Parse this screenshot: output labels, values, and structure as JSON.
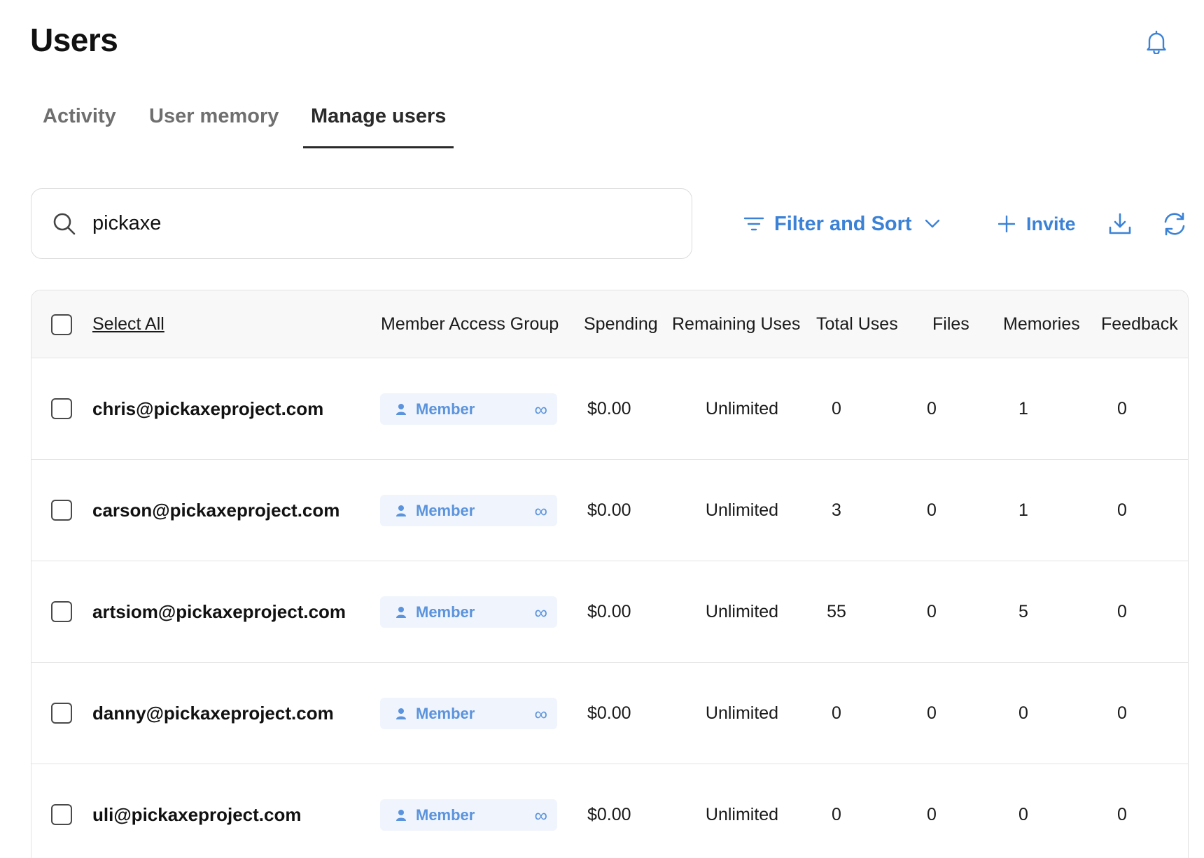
{
  "header": {
    "title": "Users"
  },
  "tabs": [
    {
      "label": "Activity",
      "active": false
    },
    {
      "label": "User memory",
      "active": false
    },
    {
      "label": "Manage users",
      "active": true
    }
  ],
  "search": {
    "value": "pickaxe",
    "icon": "search-icon"
  },
  "toolbar": {
    "filter_label": "Filter and Sort",
    "invite_label": "Invite",
    "icons": [
      "filter-icon",
      "chevron-down-icon",
      "plus-icon",
      "download-icon",
      "refresh-icon",
      "bell-icon"
    ]
  },
  "colors": {
    "accent": "#3b82d6",
    "badge_bg": "#f0f5fd",
    "badge_text": "#5b93dc"
  },
  "table": {
    "select_all_label": "Select All",
    "columns": [
      "Member Access Group",
      "Spending",
      "Remaining Uses",
      "Total Uses",
      "Files",
      "Memories",
      "Feedback"
    ],
    "rows": [
      {
        "email": "chris@pickaxeproject.com",
        "group": "Member",
        "limit": "∞",
        "spending": "$0.00",
        "remaining": "Unlimited",
        "total_uses": "0",
        "files": "0",
        "memories": "1",
        "feedback": "0"
      },
      {
        "email": "carson@pickaxeproject.com",
        "group": "Member",
        "limit": "∞",
        "spending": "$0.00",
        "remaining": "Unlimited",
        "total_uses": "3",
        "files": "0",
        "memories": "1",
        "feedback": "0"
      },
      {
        "email": "artsiom@pickaxeproject.com",
        "group": "Member",
        "limit": "∞",
        "spending": "$0.00",
        "remaining": "Unlimited",
        "total_uses": "55",
        "files": "0",
        "memories": "5",
        "feedback": "0"
      },
      {
        "email": "danny@pickaxeproject.com",
        "group": "Member",
        "limit": "∞",
        "spending": "$0.00",
        "remaining": "Unlimited",
        "total_uses": "0",
        "files": "0",
        "memories": "0",
        "feedback": "0"
      },
      {
        "email": "uli@pickaxeproject.com",
        "group": "Member",
        "limit": "∞",
        "spending": "$0.00",
        "remaining": "Unlimited",
        "total_uses": "0",
        "files": "0",
        "memories": "0",
        "feedback": "0"
      }
    ]
  }
}
